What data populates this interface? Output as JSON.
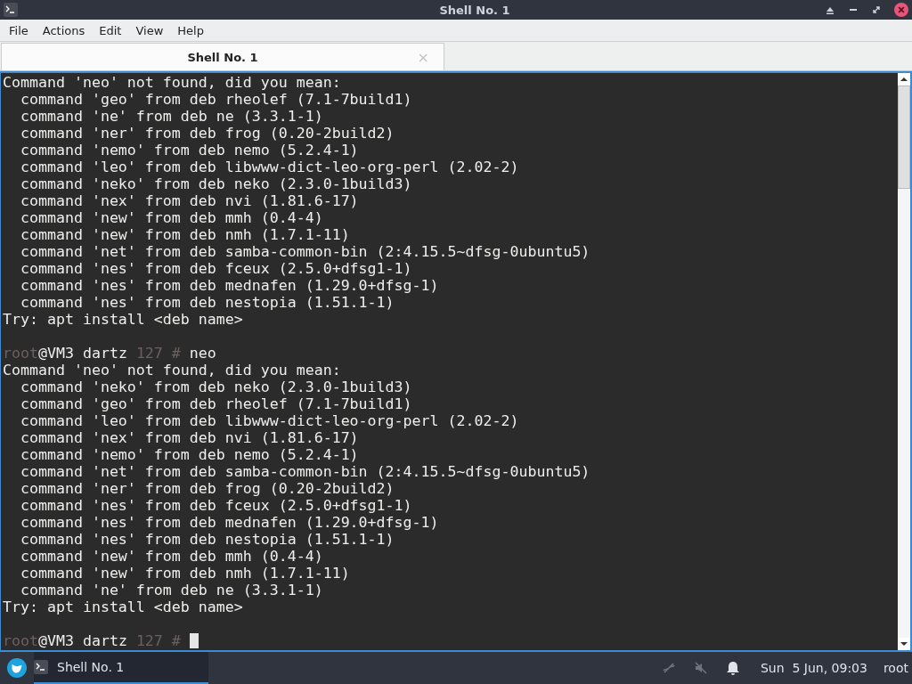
{
  "window": {
    "title": "Shell No. 1"
  },
  "menu": [
    "File",
    "Actions",
    "Edit",
    "View",
    "Help"
  ],
  "tabs": [
    {
      "label": "Shell No. 1",
      "selected": true,
      "close": "×"
    }
  ],
  "terminal": {
    "lines": [
      {
        "kind": "output",
        "text": "Command 'neo' not found, did you mean:"
      },
      {
        "kind": "output",
        "text": "  command 'geo' from deb rheolef (7.1-7build1)"
      },
      {
        "kind": "output",
        "text": "  command 'ne' from deb ne (3.3.1-1)"
      },
      {
        "kind": "output",
        "text": "  command 'ner' from deb frog (0.20-2build2)"
      },
      {
        "kind": "output",
        "text": "  command 'nemo' from deb nemo (5.2.4-1)"
      },
      {
        "kind": "output",
        "text": "  command 'leo' from deb libwww-dict-leo-org-perl (2.02-2)"
      },
      {
        "kind": "output",
        "text": "  command 'neko' from deb neko (2.3.0-1build3)"
      },
      {
        "kind": "output",
        "text": "  command 'nex' from deb nvi (1.81.6-17)"
      },
      {
        "kind": "output",
        "text": "  command 'new' from deb mmh (0.4-4)"
      },
      {
        "kind": "output",
        "text": "  command 'new' from deb nmh (1.7.1-11)"
      },
      {
        "kind": "output",
        "text": "  command 'net' from deb samba-common-bin (2:4.15.5~dfsg-0ubuntu5)"
      },
      {
        "kind": "output",
        "text": "  command 'nes' from deb fceux (2.5.0+dfsg1-1)"
      },
      {
        "kind": "output",
        "text": "  command 'nes' from deb mednafen (1.29.0+dfsg-1)"
      },
      {
        "kind": "output",
        "text": "  command 'nes' from deb nestopia (1.51.1-1)"
      },
      {
        "kind": "output",
        "text": "Try: apt install <deb name>"
      },
      {
        "kind": "blank"
      },
      {
        "kind": "prompt",
        "user": "root",
        "host": "@VM3 dartz",
        "status": "127 #",
        "command": "neo",
        "cursor": false
      },
      {
        "kind": "output",
        "text": "Command 'neo' not found, did you mean:"
      },
      {
        "kind": "output",
        "text": "  command 'neko' from deb neko (2.3.0-1build3)"
      },
      {
        "kind": "output",
        "text": "  command 'geo' from deb rheolef (7.1-7build1)"
      },
      {
        "kind": "output",
        "text": "  command 'leo' from deb libwww-dict-leo-org-perl (2.02-2)"
      },
      {
        "kind": "output",
        "text": "  command 'nex' from deb nvi (1.81.6-17)"
      },
      {
        "kind": "output",
        "text": "  command 'nemo' from deb nemo (5.2.4-1)"
      },
      {
        "kind": "output",
        "text": "  command 'net' from deb samba-common-bin (2:4.15.5~dfsg-0ubuntu5)"
      },
      {
        "kind": "output",
        "text": "  command 'ner' from deb frog (0.20-2build2)"
      },
      {
        "kind": "output",
        "text": "  command 'nes' from deb fceux (2.5.0+dfsg1-1)"
      },
      {
        "kind": "output",
        "text": "  command 'nes' from deb mednafen (1.29.0+dfsg-1)"
      },
      {
        "kind": "output",
        "text": "  command 'nes' from deb nestopia (1.51.1-1)"
      },
      {
        "kind": "output",
        "text": "  command 'new' from deb mmh (0.4-4)"
      },
      {
        "kind": "output",
        "text": "  command 'new' from deb nmh (1.7.1-11)"
      },
      {
        "kind": "output",
        "text": "  command 'ne' from deb ne (3.3.1-1)"
      },
      {
        "kind": "output",
        "text": "Try: apt install <deb name>"
      },
      {
        "kind": "blank"
      },
      {
        "kind": "prompt",
        "user": "root",
        "host": "@VM3 dartz",
        "status": "127 #",
        "cursor": true
      }
    ]
  },
  "taskbar": {
    "tasks": [
      {
        "label": "Shell No. 1",
        "selected": true
      }
    ],
    "clock": "Sun  5 Jun, 09:03",
    "user": "root"
  }
}
